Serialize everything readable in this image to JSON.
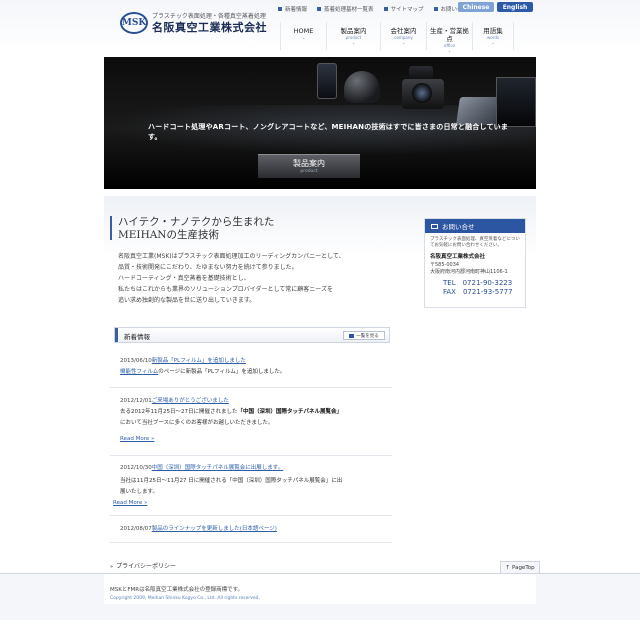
{
  "header": {
    "logo_mark": "MSK",
    "logo_sub": "プラスチック表面処理・各種真空蒸着処理",
    "logo_name": "名阪真空工業株式会社",
    "util_links": [
      "新着情報",
      "蒸着処理基材一覧表",
      "サイトマップ",
      "お問い合わせ"
    ],
    "lang_cn": "Chinese",
    "lang_en": "English",
    "nav": [
      {
        "label": "HOME",
        "en": ""
      },
      {
        "label": "製品案内",
        "en": "product"
      },
      {
        "label": "会社案内",
        "en": "company"
      },
      {
        "label": "生産・営業拠点",
        "en": "office"
      },
      {
        "label": "用語集",
        "en": "words"
      }
    ]
  },
  "hero": {
    "caption": "ハードコート処理やARコート、ノングレアコートなど、MEIHANの技術はすでに皆さまの日常と融合しています。",
    "button_label": "製品案内",
    "button_sub": "product"
  },
  "intro": {
    "title_line1": "ハイテク・ナノテクから生まれた",
    "title_line2": "MEIHANの生産技術",
    "paragraph": [
      "名阪真空工業(MSK)はプラスチック表面処理加工のリーディングカンパニーとして、",
      "品質・技術開発にこだわり、たゆまない努力を続けて参りました。",
      "ハードコーティング・真空蒸着を基礎技術とし、",
      "私たちはこれからも業界のソリューションプロバイダーとして常に顧客ニーズを",
      "追い求め独創的な製品を世に送り出していきます。"
    ]
  },
  "contact": {
    "heading": "お問い合せ",
    "lead": "プラスチック表面処理、真空蒸着などについてお気軽にお問い合わせください。",
    "company": "名阪真空工業株式会社",
    "zip": "〒585-0034",
    "address": "大阪府南河内郡河南町神山1106-1",
    "tel": "TEL　0721-90-3223",
    "fax": "FAX　0721-93-5777"
  },
  "news": {
    "heading": "新着情報",
    "list_button": "一覧を見る",
    "items": [
      {
        "date": "2013/06/10",
        "title": "新製品「PLフィルム」を追加しました",
        "link": "機能性フィルム",
        "body": "のページに新製品「PLフィルム」を追加しました。"
      },
      {
        "date": "2012/12/01",
        "title": "ご来場ありがとうございました",
        "body_pre": "去る2012年11月25日～27日に開催されました",
        "body_bold": "「中国（深圳）国際タッチパネル展覧会」",
        "body_post": "において当社ブースに多くのお客様がお越しいただきました。",
        "more": "Read More »"
      },
      {
        "date": "2012/10/30",
        "title": "中国（深圳）国際タッチパネル展覧会に出展します。",
        "body_line1": "当社は11月25日～11月27 日に開催される「中国（深圳）国際タッチパネル展覧会」に出",
        "body_line2": "展いたします。",
        "more": "Read More »"
      },
      {
        "date": "2012/08/07",
        "title": "製品のラインナップを更新しました(日本語ページ)"
      }
    ]
  },
  "footer": {
    "privacy": "プライバシーポリシー",
    "pagetop": "PageTop",
    "trademark": "MSKとFMRは名阪真空工業株式会社の登録商標です。",
    "copyright": "Copyright 2009, Meihan Shinku Kogyo Co., Ltd. All rights reserved."
  }
}
